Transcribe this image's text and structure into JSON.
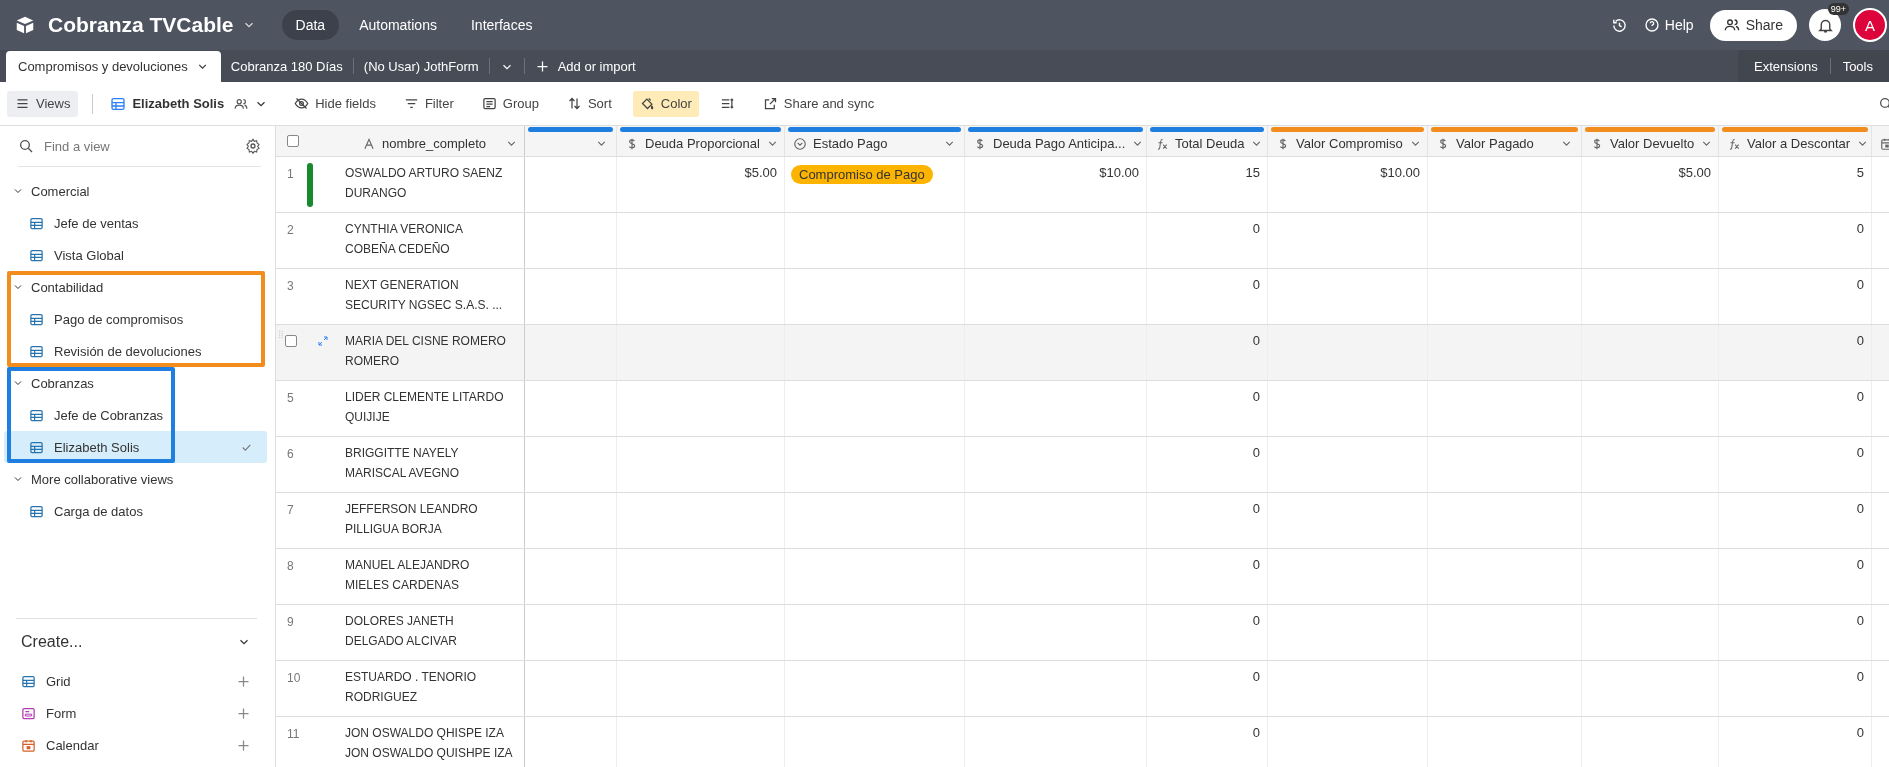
{
  "base": {
    "name": "Cobranza TVCable"
  },
  "nav_tabs": [
    {
      "label": "Data",
      "selected": true
    },
    {
      "label": "Automations",
      "selected": false
    },
    {
      "label": "Interfaces",
      "selected": false
    }
  ],
  "top_actions": {
    "help": "Help",
    "share": "Share",
    "notifications": "99+",
    "avatar": "A"
  },
  "tables": [
    {
      "label": "Compromisos y devoluciones",
      "selected": true
    },
    {
      "label": "Cobranza 180 Días",
      "selected": false
    },
    {
      "label": "(No Usar) JothForm",
      "selected": false
    }
  ],
  "add_table": "Add or import",
  "extensions": "Extensions",
  "tools": "Tools",
  "toolbar": {
    "views": "Views",
    "current_view": "Elizabeth Solis",
    "buttons": [
      {
        "kind": "hide",
        "label": "Hide fields",
        "active": false
      },
      {
        "kind": "filter",
        "label": "Filter",
        "active": false
      },
      {
        "kind": "group",
        "label": "Group",
        "active": false
      },
      {
        "kind": "sort",
        "label": "Sort",
        "active": false
      },
      {
        "kind": "color",
        "label": "Color",
        "active": true
      },
      {
        "kind": "row-height",
        "active": false
      },
      {
        "kind": "share",
        "label": "Share and sync",
        "active": false
      }
    ]
  },
  "sidebar": {
    "search": {
      "placeholder": "Find a view"
    },
    "sections": [
      {
        "label": "Comercial",
        "expanded": true,
        "items": [
          {
            "label": "Jefe de ventas",
            "selected": false
          },
          {
            "label": "Vista Global",
            "selected": false
          }
        ]
      },
      {
        "label": "Contabilidad",
        "expanded": true,
        "highlight": {
          "color": "#f28c1c",
          "full_width": true
        },
        "items": [
          {
            "label": "Pago de compromisos",
            "selected": false
          },
          {
            "label": "Revisión de devoluciones",
            "selected": false
          }
        ]
      },
      {
        "label": "Cobranzas",
        "expanded": true,
        "highlight": {
          "color": "#1f7fe0",
          "full_width": false
        },
        "items": [
          {
            "label": "Jefe de Cobranzas",
            "selected": false
          },
          {
            "label": "Elizabeth Solis",
            "selected": true
          }
        ]
      },
      {
        "label": "More collaborative views",
        "expanded": true,
        "items": [
          {
            "label": "Carga de datos",
            "selected": false
          }
        ]
      }
    ],
    "create": {
      "label": "Create...",
      "items": [
        {
          "kind": "grid",
          "label": "Grid"
        },
        {
          "kind": "form",
          "label": "Form"
        },
        {
          "kind": "calendar",
          "label": "Calendar"
        }
      ]
    }
  },
  "grid": {
    "all_checked": false,
    "columns": [
      {
        "kind": "text",
        "label": "nombre_completo"
      },
      {
        "kind": "unnamed",
        "color": "#1f7fe0"
      },
      {
        "kind": "currency",
        "label": "Deuda Proporcional",
        "color": "#1f7fe0"
      },
      {
        "kind": "select",
        "label": "Estado Pago",
        "color": "#1f7fe0"
      },
      {
        "kind": "currency",
        "label": "Deuda Pago Anticipa...",
        "color": "#1f7fe0"
      },
      {
        "kind": "formula",
        "label": "Total Deuda",
        "color": "#1f7fe0"
      },
      {
        "kind": "currency",
        "label": "Valor Compromiso",
        "color": "#f28c1c"
      },
      {
        "kind": "currency",
        "label": "Valor Pagado",
        "color": "#f28c1c"
      },
      {
        "kind": "currency",
        "label": "Valor Devuelto",
        "color": "#f28c1c"
      },
      {
        "kind": "formula",
        "label": "Valor a Descontar",
        "color": "#f28c1c"
      },
      {
        "kind": "date"
      }
    ],
    "rows": [
      {
        "number": "1",
        "color": "#168a2c",
        "hovered": false,
        "checked": false,
        "cells": [
          "OSWALDO ARTURO SAENZ DURANGO",
          "",
          "$5.00",
          {
            "text": "Compromiso de Pago",
            "color": "#fcb400"
          },
          "$10.00",
          "15",
          "$10.00",
          "",
          "$5.00",
          "5"
        ]
      },
      {
        "number": "2",
        "hovered": false,
        "checked": false,
        "cells": [
          "CYNTHIA VERONICA COBEÑA CEDEÑO",
          "",
          "",
          "",
          "",
          "0",
          "",
          "",
          "",
          "0"
        ]
      },
      {
        "number": "3",
        "hovered": false,
        "checked": false,
        "cells": [
          "NEXT GENERATION SECURITY NGSEC S.A.S. ...",
          "",
          "",
          "",
          "",
          "0",
          "",
          "",
          "",
          "0"
        ]
      },
      {
        "hovered": true,
        "checked": false,
        "cells": [
          "MARIA DEL CISNE ROMERO ROMERO",
          "",
          "",
          "",
          "",
          "0",
          "",
          "",
          "",
          "0"
        ]
      },
      {
        "number": "5",
        "hovered": false,
        "checked": false,
        "cells": [
          "LIDER CLEMENTE LITARDO QUIJIJE",
          "",
          "",
          "",
          "",
          "0",
          "",
          "",
          "",
          "0"
        ]
      },
      {
        "number": "6",
        "hovered": false,
        "checked": false,
        "cells": [
          "BRIGGITTE NAYELY MARISCAL AVEGNO",
          "",
          "",
          "",
          "",
          "0",
          "",
          "",
          "",
          "0"
        ]
      },
      {
        "number": "7",
        "hovered": false,
        "checked": false,
        "cells": [
          "JEFFERSON LEANDRO PILLIGUA BORJA",
          "",
          "",
          "",
          "",
          "0",
          "",
          "",
          "",
          "0"
        ]
      },
      {
        "number": "8",
        "hovered": false,
        "checked": false,
        "cells": [
          "MANUEL ALEJANDRO MIELES CARDENAS",
          "",
          "",
          "",
          "",
          "0",
          "",
          "",
          "",
          "0"
        ]
      },
      {
        "number": "9",
        "hovered": false,
        "checked": false,
        "cells": [
          "DOLORES JANETH DELGADO ALCIVAR",
          "",
          "",
          "",
          "",
          "0",
          "",
          "",
          "",
          "0"
        ]
      },
      {
        "number": "10",
        "hovered": false,
        "checked": false,
        "cells": [
          "ESTUARDO . TENORIO RODRIGUEZ",
          "",
          "",
          "",
          "",
          "0",
          "",
          "",
          "",
          "0"
        ]
      },
      {
        "number": "11",
        "hovered": false,
        "checked": false,
        "cells": [
          "JON OSWALDO QHISPE IZA JON OSWALDO QUISHPE IZA",
          "",
          "",
          "",
          "",
          "0",
          "",
          "",
          "",
          "0"
        ]
      }
    ]
  }
}
